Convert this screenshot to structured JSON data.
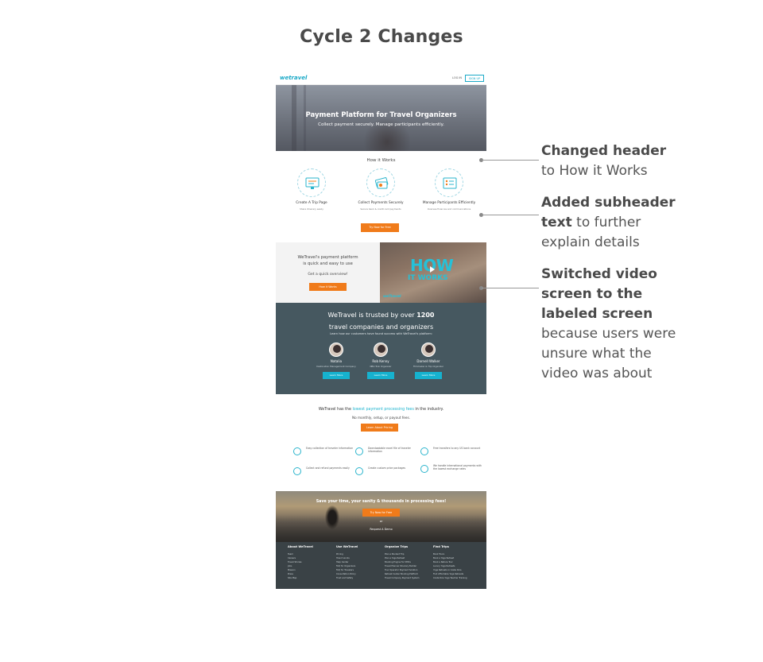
{
  "slide": {
    "title": "Cycle 2 Changes"
  },
  "mock": {
    "nav": {
      "logo": "wetravel",
      "login": "LOG IN",
      "signup": "SIGN UP"
    },
    "hero": {
      "title": "Payment Platform for Travel Organizers",
      "subtitle": "Collect payment securely. Manage participants efficiently."
    },
    "how": {
      "heading": "How it Works",
      "steps": [
        {
          "title": "Create A Trip Page",
          "sub": "Share itinerary easily"
        },
        {
          "title": "Collect Payments Securely",
          "sub": "Secure bank & credit card payments"
        },
        {
          "title": "Manage Participants Efficiently",
          "sub": "Oversee finances and communications"
        }
      ],
      "cta": "Try Now for Free"
    },
    "video": {
      "line1": "WeTravel's payment platform",
      "line2": "is quick and easy to use",
      "line3": "Get a quick overview!",
      "button": "How it Works",
      "overlay1": "HOW",
      "overlay2": "IT WORKS",
      "brand": "weTravel"
    },
    "trust": {
      "line1_pre": "WeTravel is trusted by over ",
      "line1_num": "1200",
      "line2": "travel companies and organizers",
      "line3": "Learn how our customers have found success with WeTravel's platform:",
      "people": [
        {
          "name": "Natalia",
          "role": "Destination Management Company",
          "button": "Learn More"
        },
        {
          "name": "Rob Kenny",
          "role": "NBA Trek Organizer",
          "button": "Learn More"
        },
        {
          "name": "Darnell Walker",
          "role": "Filmmaker & Trip Organizer",
          "button": "Learn More"
        }
      ]
    },
    "pricing": {
      "line1_pre": "WeTravel has the ",
      "line1_hl": "lowest payment processing fees",
      "line1_post": " in the industry.",
      "line2": "No monthly, setup, or payout fees.",
      "button": "Learn About Pricing",
      "features": [
        "Easy collection of traveler information",
        "Downloadable excel file of traveler information",
        "Free transfers to any US bank account",
        "Collect and refund payments easily",
        "Create custom price packages",
        "We handle international payments with the lowest exchange rates"
      ]
    },
    "cta": {
      "line1": "Save your time, your sanity & thousands in processing fees!",
      "button": "Try Now for Free",
      "or": "or",
      "demo": "Request A Demo"
    },
    "footer": {
      "columns": [
        {
          "heading": "About WeTravel",
          "links": [
            "Team",
            "Careers",
            "Travel Stories",
            "Jobs",
            "Mission",
            "Press",
            "Site Map"
          ]
        },
        {
          "heading": "Use WeTravel",
          "links": [
            "Pricing",
            "How it works",
            "Help Center",
            "FAQ for Organizers",
            "FAQ for Travelers",
            "Consultation Policy",
            "Trust and Safety"
          ]
        },
        {
          "heading": "Organize Trips",
          "links": [
            "Plan a Student Trip",
            "Plan a Yoga Retreat",
            "Booking Engine for DMCs",
            "Travel Planner Itinerary Builder",
            "Tour Operator Payment Solution",
            "Retreat Center Booking Platform",
            "Travel Company Payment System"
          ]
        },
        {
          "heading": "Find Trips",
          "links": [
            "Book Tours",
            "Book a Yoga Retreat",
            "Book a Nature Tour",
            "Luxury Yoga Retreats",
            "Yoga Retreats in Costa Rica",
            "Find Affordable Yoga Retreats",
            "Costa Rica Yoga Teacher Training"
          ]
        }
      ]
    }
  },
  "annotations": [
    {
      "bold": "Changed header",
      "rest": " to How it Works"
    },
    {
      "bold": "Added subheader text",
      "rest": " to further explain details"
    },
    {
      "bold": "Switched video screen to the labeled screen",
      "rest": " because users were unsure what the video was about"
    }
  ]
}
